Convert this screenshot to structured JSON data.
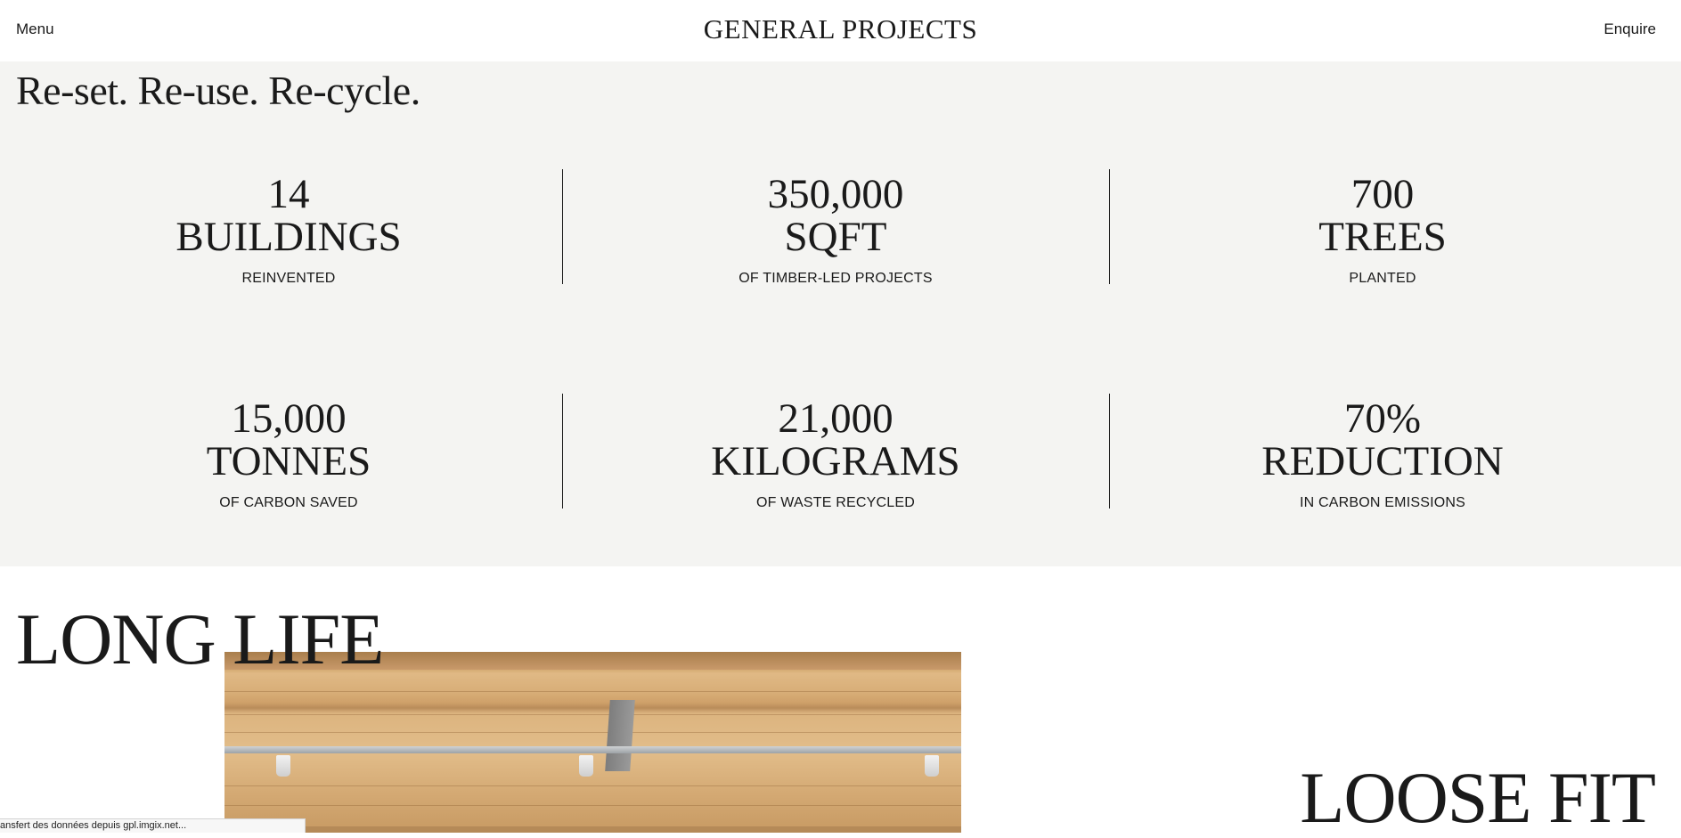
{
  "header": {
    "menu_label": "Menu",
    "logo_text": "GENERAL PROJECTS",
    "enquire_label": "Enquire"
  },
  "stats": {
    "headline": "Re-set. Re-use. Re-cycle.",
    "items": [
      {
        "number": "14",
        "unit": "BUILDINGS",
        "caption": "REINVENTED"
      },
      {
        "number": "350,000",
        "unit": "SQFT",
        "caption": "OF TIMBER-LED PROJECTS"
      },
      {
        "number": "700",
        "unit": "TREES",
        "caption": "PLANTED"
      },
      {
        "number": "15,000",
        "unit": "TONNES",
        "caption": "OF CARBON SAVED"
      },
      {
        "number": "21,000",
        "unit": "KILOGRAMS",
        "caption": "OF WASTE RECYCLED"
      },
      {
        "number": "70%",
        "unit": "REDUCTION",
        "caption": "IN CARBON EMISSIONS"
      }
    ]
  },
  "principles": {
    "long_life": "LONG LIFE",
    "loose_fit": "LOOSE FIT"
  },
  "status_bar": {
    "text": "ansfert des données depuis gpl.imgix.net..."
  },
  "colors": {
    "page_background": "#ffffff",
    "stats_background": "#f4f4f2",
    "text": "#1a1a1a"
  }
}
